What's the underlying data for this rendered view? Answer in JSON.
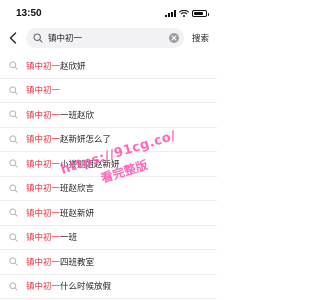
{
  "status": {
    "time": "13:50",
    "battery_level": 0.85
  },
  "search": {
    "query": "镇中初一",
    "button_label": "搜索"
  },
  "suggestions": [
    {
      "highlight": "镇中初一",
      "rest": "赵欣妍"
    },
    {
      "highlight": "镇中初一",
      "rest": ""
    },
    {
      "highlight": "镇中初一",
      "rest": "一班赵欣"
    },
    {
      "highlight": "镇中初一",
      "rest": "赵新妍怎么了"
    },
    {
      "highlight": "镇中初一",
      "rest": "小搂鹅姐赵新妍"
    },
    {
      "highlight": "镇中初一",
      "rest": "班赵欣言"
    },
    {
      "highlight": "镇中初一",
      "rest": "班赵新妍"
    },
    {
      "highlight": "镇中初一",
      "rest": "一班"
    },
    {
      "highlight": "镇中初一",
      "rest": "四班教室"
    },
    {
      "highlight": "镇中初一",
      "rest": "什么时候放假"
    }
  ],
  "watermark": {
    "url": "https://91cg.co/",
    "sub": "看完整版"
  },
  "colors": {
    "highlight": "#e8313f",
    "search_bg": "#f2f2f4",
    "watermark": "#ff4fae"
  }
}
